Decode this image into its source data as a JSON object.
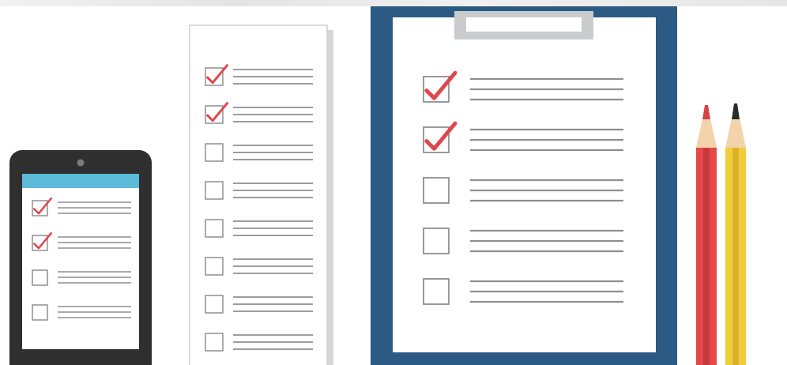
{
  "colors": {
    "background": "#ffffff",
    "clipboard_board": "#2b5a84",
    "clipboard_paper": "#ffffff",
    "clip": "#c9cbcd",
    "tablet_frame": "#2f2f2f",
    "tablet_header": "#5bbbd9",
    "checkmark": "#e0474c",
    "line": "#8f8f8f",
    "checkbox_border": "#8f8f8f",
    "pencil_red": "#e5474b",
    "pencil_yellow": "#f2cd3b",
    "pencil_wood": "#f3d3a9",
    "paper_shadow": "#d7d7d7"
  },
  "tablet": {
    "items": [
      {
        "checked": true
      },
      {
        "checked": true
      },
      {
        "checked": false
      },
      {
        "checked": false
      }
    ]
  },
  "paper_list": {
    "items": [
      {
        "checked": true
      },
      {
        "checked": true
      },
      {
        "checked": false
      },
      {
        "checked": false
      },
      {
        "checked": false
      },
      {
        "checked": false
      },
      {
        "checked": false
      },
      {
        "checked": false
      }
    ]
  },
  "clipboard": {
    "items": [
      {
        "checked": true
      },
      {
        "checked": true
      },
      {
        "checked": false
      },
      {
        "checked": false
      },
      {
        "checked": false
      }
    ]
  },
  "pencils": [
    {
      "color": "red"
    },
    {
      "color": "yellow"
    }
  ]
}
